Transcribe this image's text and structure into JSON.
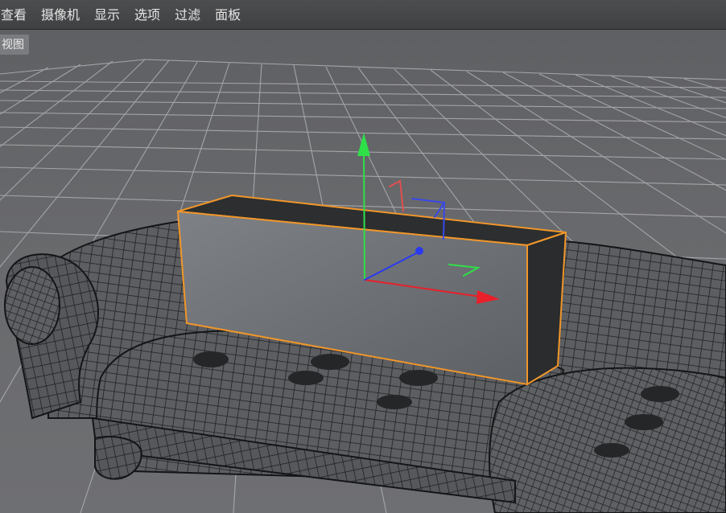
{
  "menubar": {
    "items": [
      "查看",
      "摄像机",
      "显示",
      "选项",
      "过滤",
      "面板"
    ]
  },
  "viewport": {
    "label": "视图",
    "selection_color": "#f0962a",
    "axis_colors": {
      "x": "#e8202a",
      "y": "#2ee048",
      "z": "#2a3af0"
    }
  }
}
